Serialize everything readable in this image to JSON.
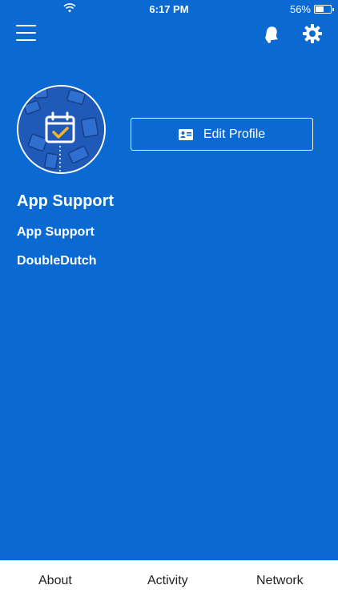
{
  "status_bar": {
    "time": "6:17 PM",
    "battery_percent": "56%",
    "battery_level": 0.56,
    "icons": [
      "wifi-icon",
      "battery-icon"
    ]
  },
  "header": {
    "icons": [
      "menu-icon",
      "bell-icon",
      "gear-icon"
    ]
  },
  "profile": {
    "avatar_icon": "calendar-check-icon",
    "edit_button_label": "Edit Profile",
    "edit_button_icon": "id-card-icon",
    "name": "App Support",
    "title": "App Support",
    "company": "DoubleDutch"
  },
  "tabs": [
    {
      "label": "About"
    },
    {
      "label": "Activity"
    },
    {
      "label": "Network"
    }
  ],
  "colors": {
    "background": "#0b6ad1",
    "accent": "#f3b52a",
    "tabbar_bg": "#ffffff",
    "tab_text": "#222222"
  }
}
